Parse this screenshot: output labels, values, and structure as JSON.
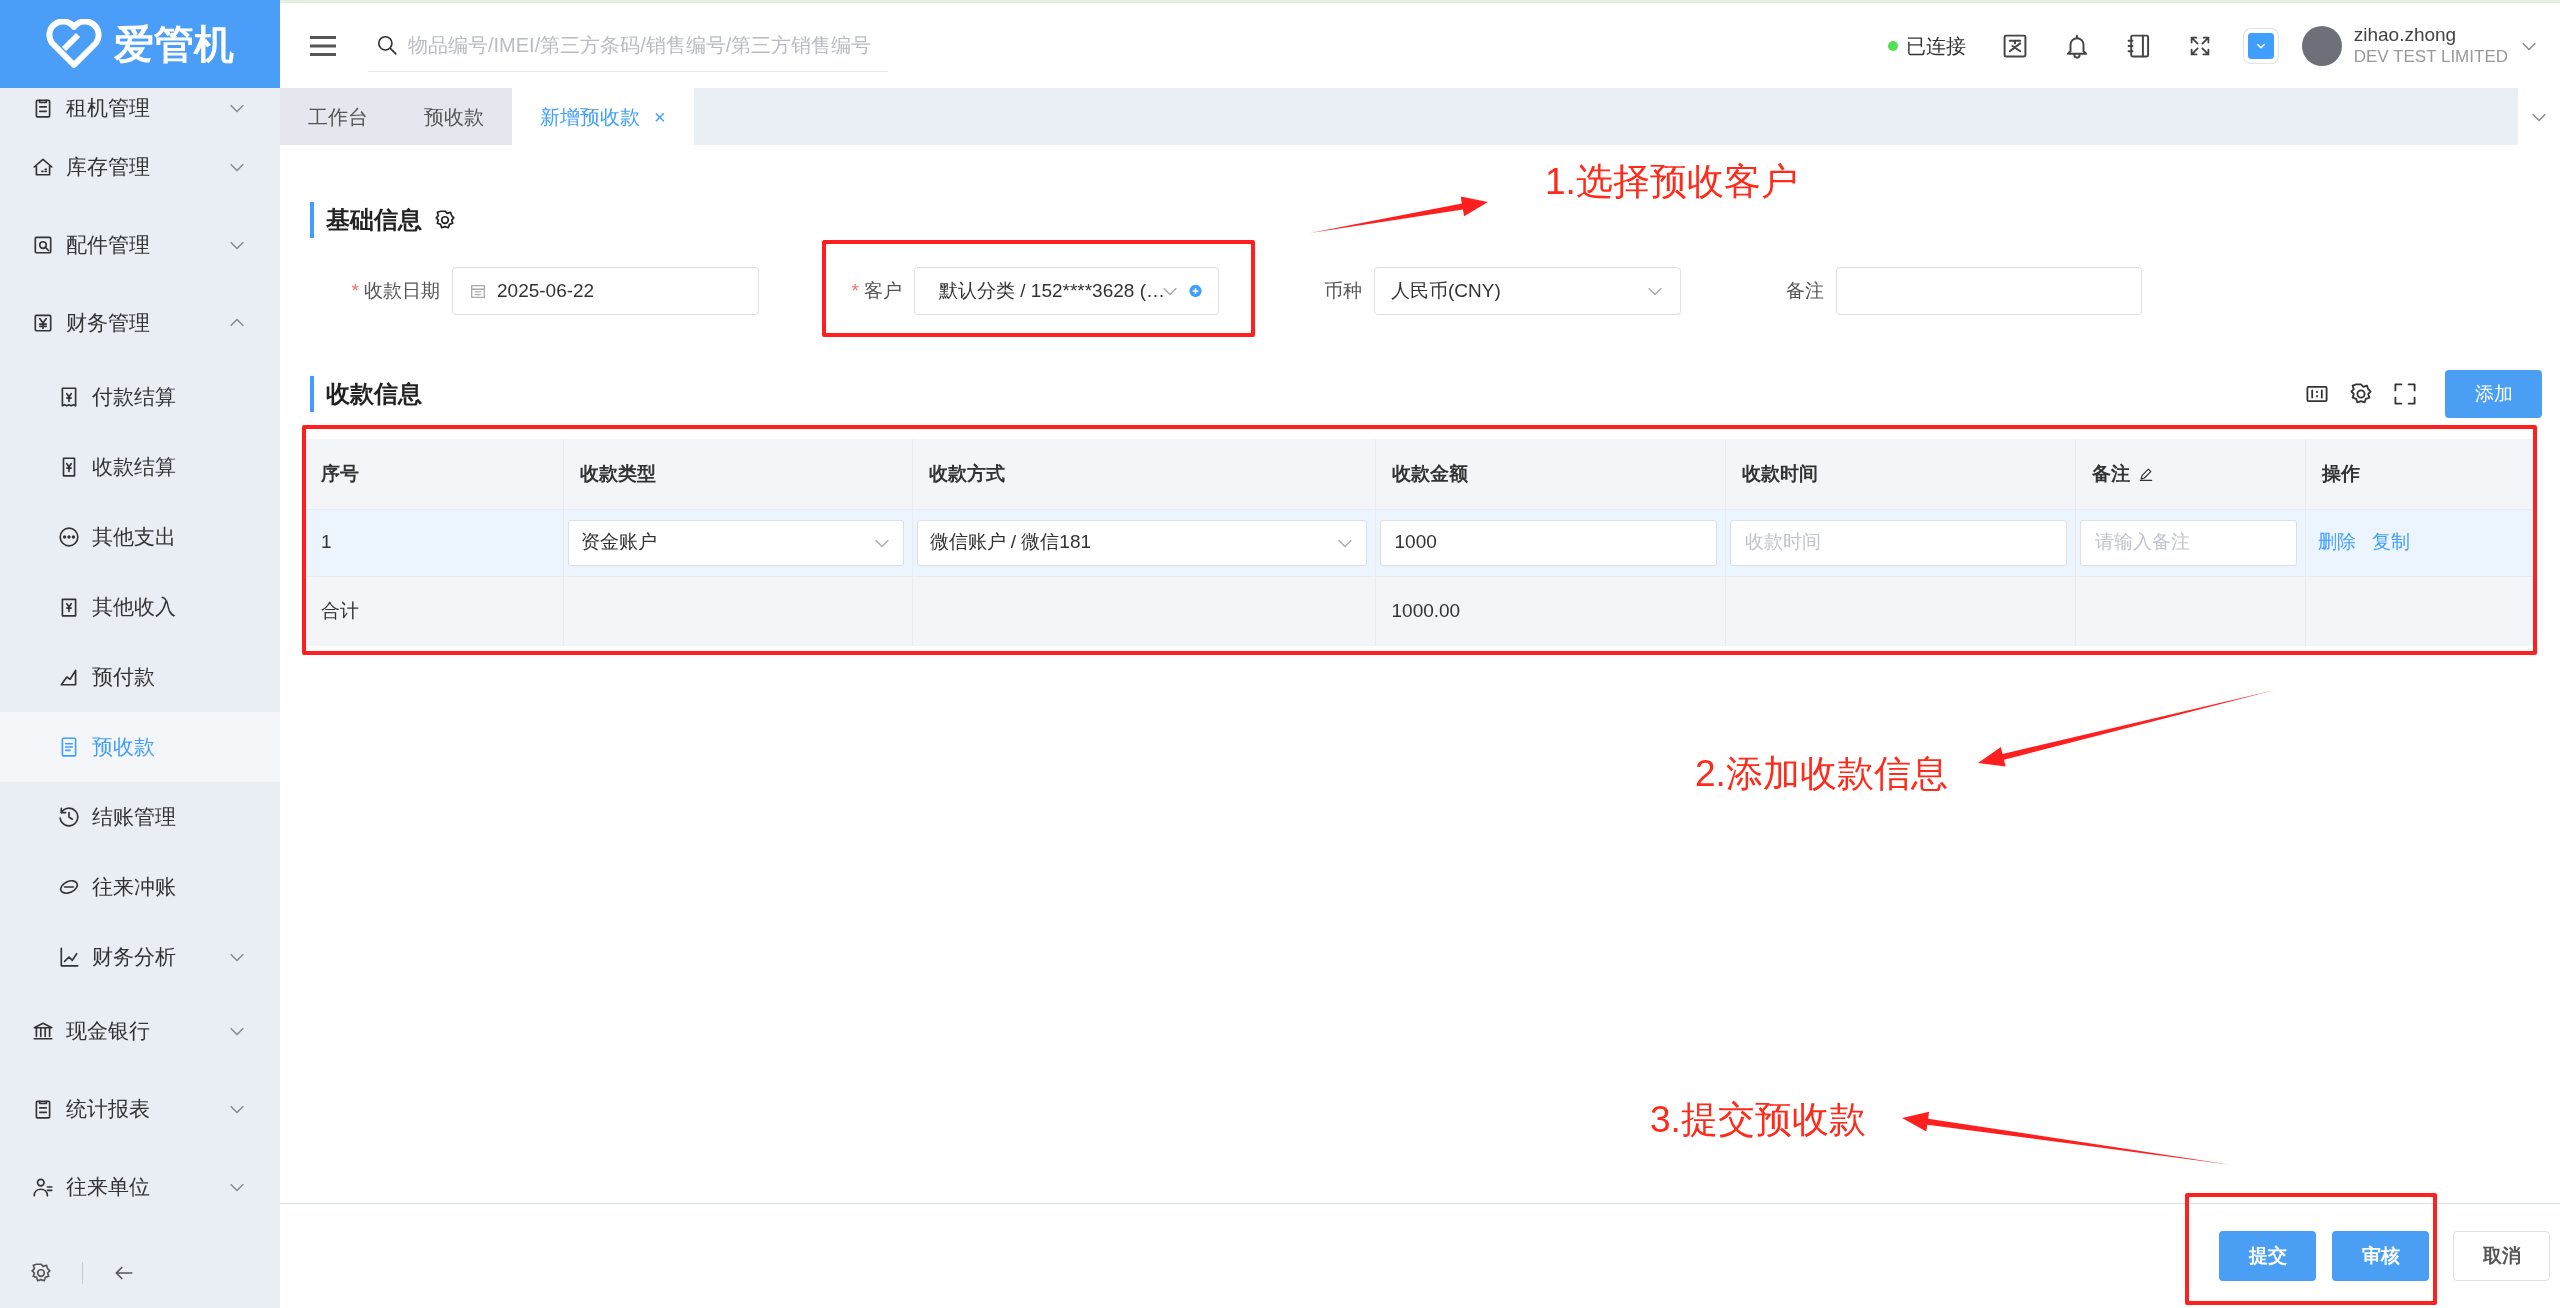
{
  "app": {
    "logo": "爱管机"
  },
  "sidebar": {
    "items": [
      {
        "label": "租机管理",
        "expanded": false
      },
      {
        "label": "库存管理",
        "expanded": false
      },
      {
        "label": "配件管理",
        "expanded": false
      },
      {
        "label": "财务管理",
        "expanded": true,
        "children": [
          {
            "label": "付款结算",
            "selected": false
          },
          {
            "label": "收款结算",
            "selected": false
          },
          {
            "label": "其他支出",
            "selected": false
          },
          {
            "label": "其他收入",
            "selected": false
          },
          {
            "label": "预付款",
            "selected": false
          },
          {
            "label": "预收款",
            "selected": true
          },
          {
            "label": "结账管理",
            "selected": false
          },
          {
            "label": "往来冲账",
            "selected": false
          },
          {
            "label": "财务分析",
            "selected": false,
            "expanded": false
          }
        ]
      },
      {
        "label": "现金银行",
        "expanded": false
      },
      {
        "label": "统计报表",
        "expanded": false
      },
      {
        "label": "往来单位",
        "expanded": false
      }
    ]
  },
  "header": {
    "search": {
      "placeholder": "物品编号/IMEI/第三方条码/销售编号/第三方销售编号"
    },
    "connection": {
      "label": "已连接",
      "connected": true
    },
    "user": {
      "name": "zihao.zhong",
      "company": "DEV TEST LIMITED"
    }
  },
  "tabs": [
    {
      "label": "工作台",
      "selected": false
    },
    {
      "label": "预收款",
      "selected": false
    },
    {
      "label": "新增预收款",
      "selected": true,
      "close": "×"
    }
  ],
  "basic_info": {
    "title": "基础信息",
    "fields": [
      {
        "kind": "date",
        "label": "收款日期",
        "mark": "*",
        "value": "2025-06-22"
      },
      {
        "kind": "customer",
        "label": "客户",
        "mark": "*",
        "value": "默认分类 / 152****3628 (…"
      },
      {
        "kind": "select",
        "label": "币种",
        "value": "人民币(CNY)"
      },
      {
        "kind": "text",
        "label": "备注"
      }
    ]
  },
  "payment_info": {
    "title": "收款信息",
    "add_button": "添加",
    "table": {
      "columns": [
        {
          "label": "序号"
        },
        {
          "label": "收款类型"
        },
        {
          "label": "收款方式"
        },
        {
          "label": "收款金额"
        },
        {
          "label": "收款时间"
        },
        {
          "label": "备注",
          "editable": true
        },
        {
          "label": "操作"
        }
      ],
      "rows": [
        {
          "highlighted": true,
          "cells": [
            {
              "kind": "text",
              "value": "1"
            },
            {
              "kind": "select",
              "value": "资金账户"
            },
            {
              "kind": "select",
              "value": "微信账户 / 微信181"
            },
            {
              "kind": "input",
              "value": "1000"
            },
            {
              "kind": "input",
              "placeholder": "收款时间"
            },
            {
              "kind": "input",
              "placeholder": "请输入备注"
            },
            {
              "kind": "actions",
              "links": [
                "删除",
                "复制"
              ]
            }
          ]
        }
      ],
      "total": {
        "label": "合计",
        "amount": "1000.00"
      }
    }
  },
  "footer": {
    "buttons": [
      {
        "label": "提交",
        "kind": "primary"
      },
      {
        "label": "审核",
        "kind": "primary"
      },
      {
        "label": "取消",
        "kind": "default"
      }
    ]
  },
  "annotations": [
    {
      "text": "1.选择预收客户"
    },
    {
      "text": "2.添加收款信息"
    },
    {
      "text": "3.提交预收款"
    }
  ]
}
